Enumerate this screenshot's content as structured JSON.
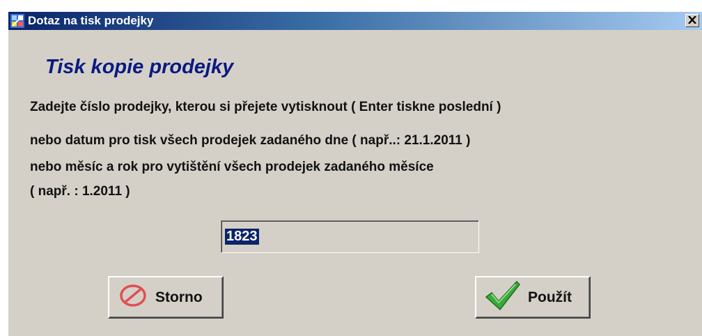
{
  "window": {
    "title": "Dotaz na tisk prodejky",
    "app_icon": "app-icon",
    "close_icon": "close-icon"
  },
  "content": {
    "heading": "Tisk kopie prodejky",
    "instructions": [
      "Zadejte číslo prodejky, kterou si přejete vytisknout ( Enter tiskne poslední )",
      "nebo datum pro tisk všech prodejek zadaného dne ( např..: 21.1.2011 )",
      "nebo měsíc a rok pro vytištění všech prodejek zadaného měsíce",
      "( např. : 1.2011 )"
    ]
  },
  "input": {
    "value": "1823",
    "selected": true
  },
  "buttons": {
    "cancel": {
      "label": "Storno",
      "icon": "prohibited-icon",
      "icon_color": "#e05050"
    },
    "ok": {
      "label": "Použít",
      "icon": "checkmark-icon",
      "icon_color": "#3aa83a"
    }
  },
  "colors": {
    "dialog_bg": "#d4d0c8",
    "titlebar_start": "#0a246a",
    "titlebar_end": "#a6caf0",
    "heading": "#0a1a80",
    "selection": "#0a246a"
  }
}
